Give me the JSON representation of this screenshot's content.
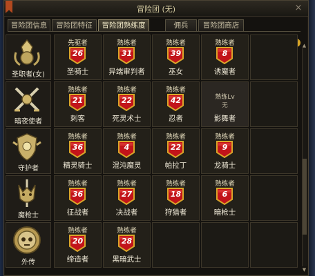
{
  "window": {
    "title": "冒险团 (无)"
  },
  "tabs": [
    {
      "label": "冒险团信息",
      "active": false
    },
    {
      "label": "冒险团特征",
      "active": false
    },
    {
      "label": "冒险团熟练度",
      "active": true
    },
    {
      "label": "佣兵",
      "active": false
    },
    {
      "label": "冒险团商店",
      "active": false
    }
  ],
  "rows": [
    {
      "class_name": "圣职者(女)",
      "emblem": "mitre-crest-icon",
      "chars": [
        {
          "rank": "先驱者",
          "level": "26",
          "name": "圣骑士"
        },
        {
          "rank": "熟练者",
          "level": "31",
          "name": "异端审判者"
        },
        {
          "rank": "熟练者",
          "level": "39",
          "name": "巫女"
        },
        {
          "rank": "熟练者",
          "level": "8",
          "name": "诱魔者"
        }
      ]
    },
    {
      "class_name": "暗夜使者",
      "emblem": "crossed-blades-crest-icon",
      "chars": [
        {
          "rank": "熟练者",
          "level": "21",
          "name": "刺客"
        },
        {
          "rank": "熟练者",
          "level": "22",
          "name": "死灵术士"
        },
        {
          "rank": "熟练者",
          "level": "42",
          "name": "忍者"
        },
        {
          "rank": "熟练Lv",
          "level": "无",
          "name": "影舞者",
          "plain": true
        }
      ]
    },
    {
      "class_name": "守护者",
      "emblem": "shield-crest-icon",
      "chars": [
        {
          "rank": "熟练者",
          "level": "36",
          "name": "精灵骑士"
        },
        {
          "rank": "熟练者",
          "level": "4",
          "name": "混沌魔灵"
        },
        {
          "rank": "熟练者",
          "level": "22",
          "name": "帕拉丁"
        },
        {
          "rank": "熟练者",
          "level": "9",
          "name": "龙骑士"
        }
      ]
    },
    {
      "class_name": "魔枪士",
      "emblem": "demon-spear-crest-icon",
      "chars": [
        {
          "rank": "熟练者",
          "level": "36",
          "name": "征战者"
        },
        {
          "rank": "熟练者",
          "level": "27",
          "name": "决战者"
        },
        {
          "rank": "熟练者",
          "level": "18",
          "name": "狩猎者"
        },
        {
          "rank": "熟练者",
          "level": "6",
          "name": "暗枪士"
        }
      ]
    },
    {
      "class_name": "外传",
      "emblem": "skull-medallion-icon",
      "chars": [
        {
          "rank": "熟练者",
          "level": "20",
          "name": "缔造者"
        },
        {
          "rank": "熟练者",
          "level": "28",
          "name": "黑暗武士"
        }
      ]
    }
  ],
  "help_icon": "?",
  "colors": {
    "badge_red": "#c2141a",
    "badge_gold": "#d9a62a",
    "frame": "#4a4233"
  }
}
